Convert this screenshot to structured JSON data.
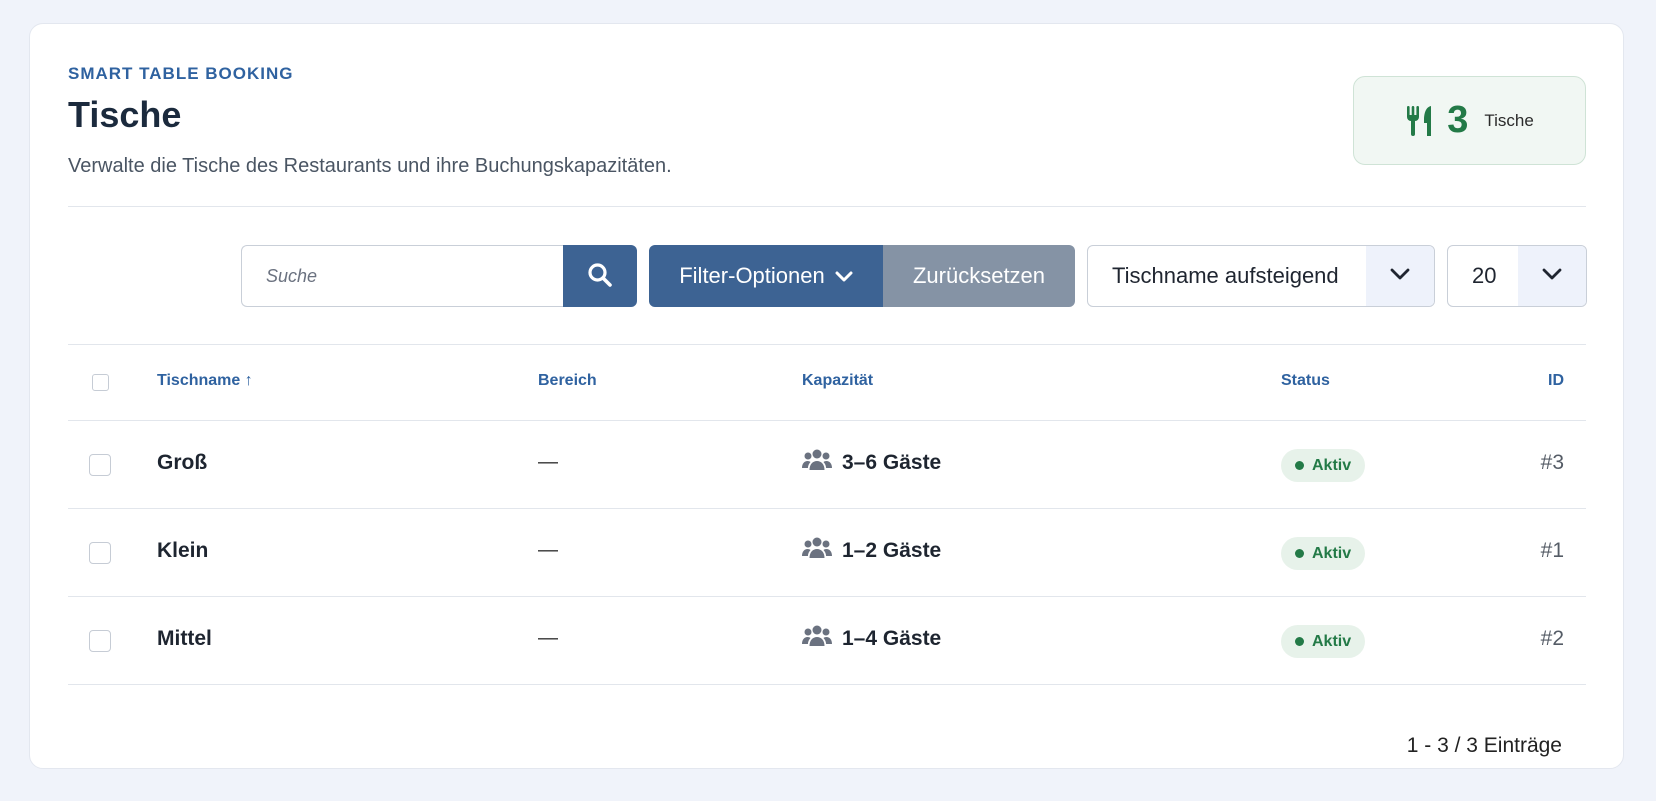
{
  "header": {
    "eyebrow": "SMART TABLE BOOKING",
    "title": "Tische",
    "subtitle": "Verwalte die Tische des Restaurants und ihre Buchungskapazitäten."
  },
  "stat": {
    "icon": "utensils-icon",
    "count": "3",
    "label": "Tische",
    "color": "#237a47"
  },
  "toolbar": {
    "search_placeholder": "Suche",
    "search_value": "",
    "filter_label": "Filter-Optionen",
    "reset_label": "Zurücksetzen",
    "sort_value": "Tischname aufsteigend",
    "limit_value": "20",
    "accent": "#3d6393"
  },
  "table": {
    "columns": {
      "name": "Tischname ↑",
      "area": "Bereich",
      "capacity": "Kapazität",
      "status": "Status",
      "id": "ID"
    },
    "rows": [
      {
        "name": "Groß",
        "area": "—",
        "capacity": "3–6 Gäste",
        "status": "Aktiv",
        "id": "#3"
      },
      {
        "name": "Klein",
        "area": "—",
        "capacity": "1–2 Gäste",
        "status": "Aktiv",
        "id": "#1"
      },
      {
        "name": "Mittel",
        "area": "—",
        "capacity": "1–4 Gäste",
        "status": "Aktiv",
        "id": "#2"
      }
    ]
  },
  "footer": {
    "pagination": "1 - 3 / 3 Einträge"
  }
}
